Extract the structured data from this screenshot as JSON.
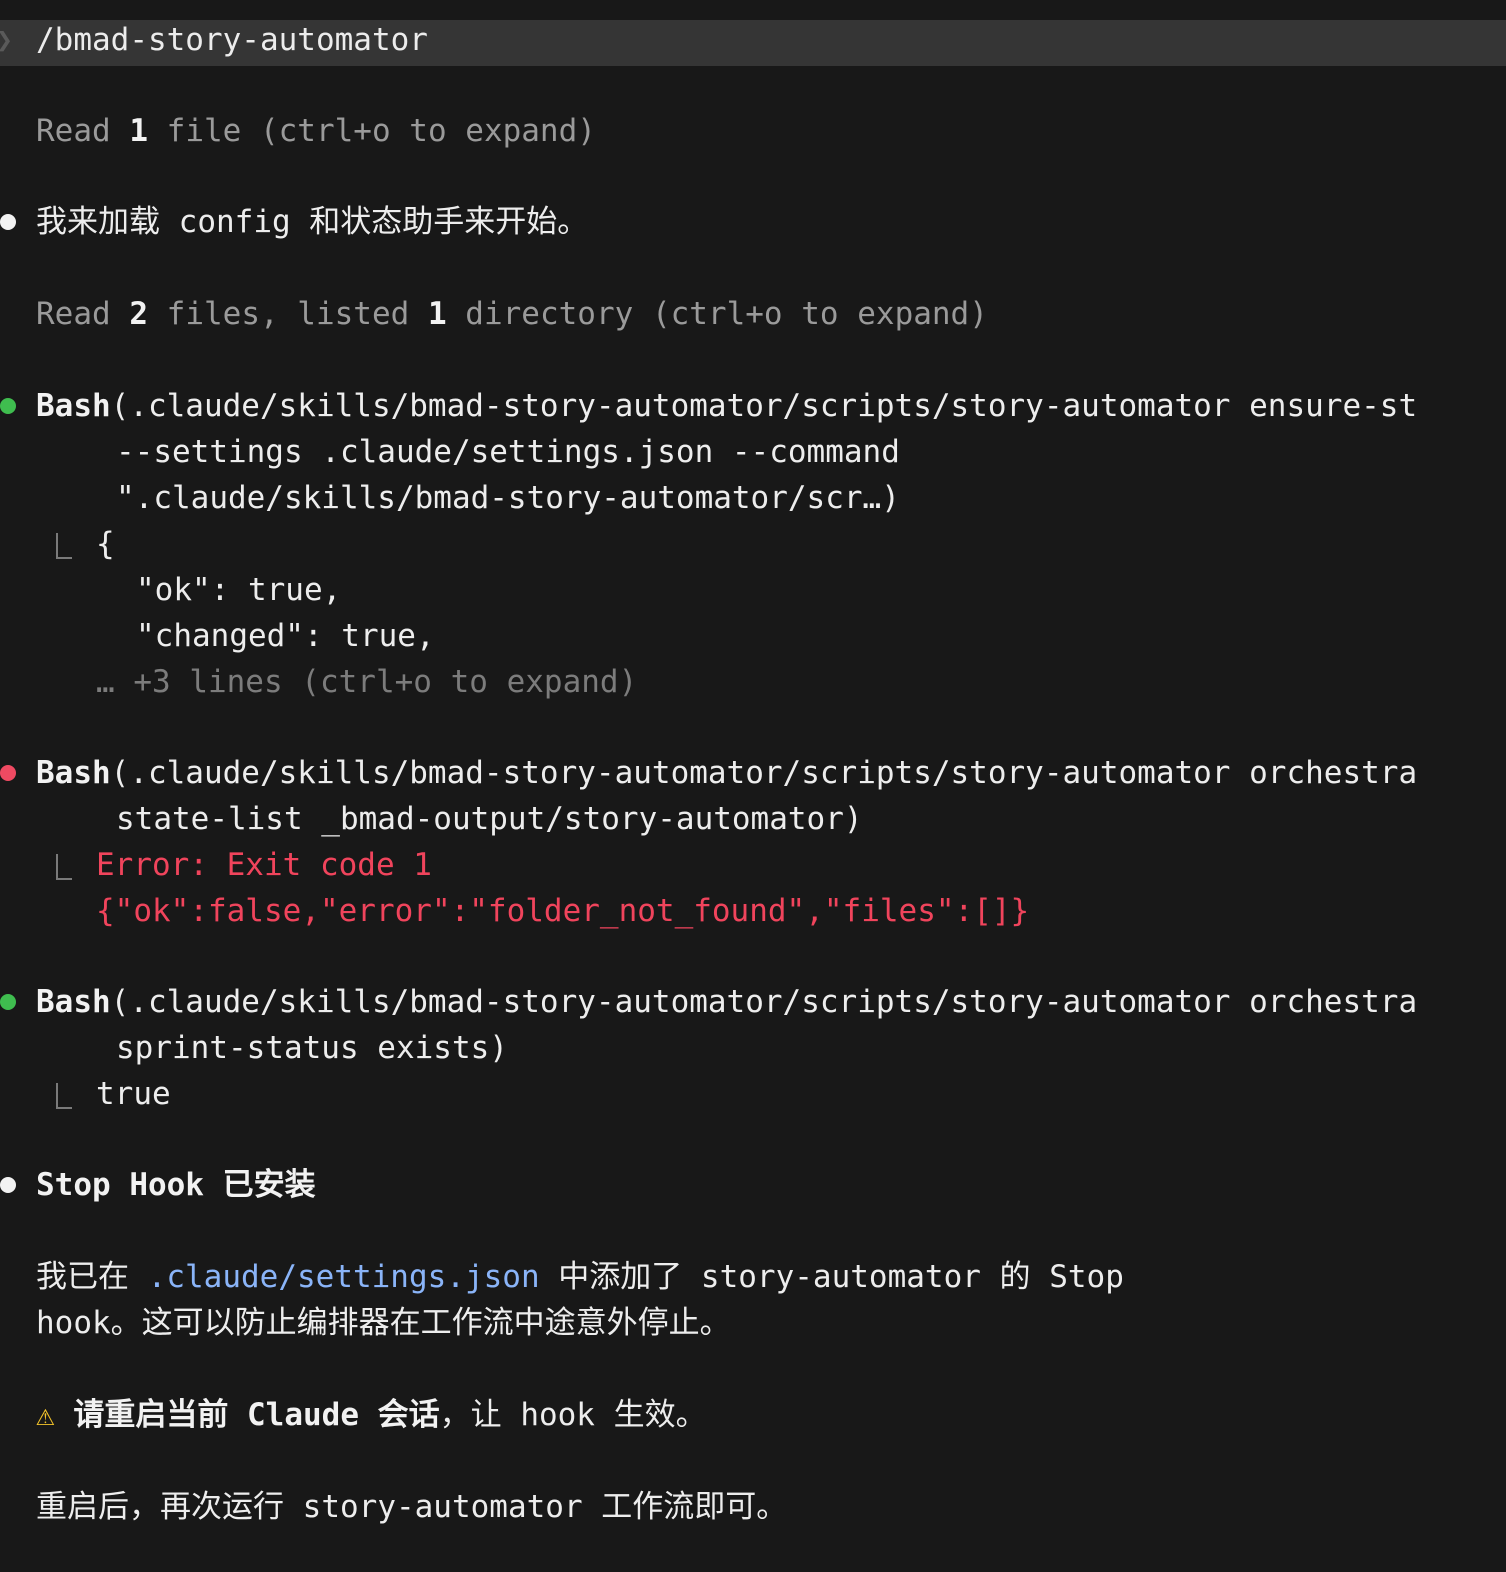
{
  "prompt": {
    "chevron": "❯",
    "command": "/bmad-story-automator"
  },
  "read1": {
    "a": "Read ",
    "n": "1",
    "b": " file (ctrl+o to expand)"
  },
  "msg1": "我来加载 config 和状态助手来开始。",
  "read2": {
    "a": "Read ",
    "n1": "2",
    "b": " files, listed ",
    "n2": "1",
    "c": " directory (ctrl+o to expand)"
  },
  "bash1": {
    "tool": "Bash",
    "line1": "(.claude/skills/bmad-story-automator/scripts/story-automator ensure-st",
    "line2": "--settings .claude/settings.json --command",
    "line3": "\".claude/skills/bmad-story-automator/scr…)",
    "out1": "{",
    "out2": "\"ok\": true,",
    "out3": "\"changed\": true,",
    "more": "… +3 lines (ctrl+o to expand)"
  },
  "bash2": {
    "tool": "Bash",
    "line1": "(.claude/skills/bmad-story-automator/scripts/story-automator orchestra",
    "line2": "state-list _bmad-output/story-automator)",
    "err1": "Error: Exit code 1",
    "err2": "{\"ok\":false,\"error\":\"folder_not_found\",\"files\":[]}"
  },
  "bash3": {
    "tool": "Bash",
    "line1": "(.claude/skills/bmad-story-automator/scripts/story-automator orchestra",
    "line2": "sprint-status exists)",
    "out": "true"
  },
  "stophook": {
    "heading": "Stop Hook 已安装",
    "p1_a": "我已在 ",
    "p1_link": ".claude/settings.json",
    "p1_b": " 中添加了 story-automator 的 Stop",
    "p1_c": "hook。这可以防止编排器在工作流中途意外停止。",
    "warn_icon": "⚠",
    "warn_bold": "请重启当前 Claude 会话",
    "warn_rest": "，让 hook 生效。",
    "final": "重启后，再次运行 story-automator 工作流即可。"
  }
}
